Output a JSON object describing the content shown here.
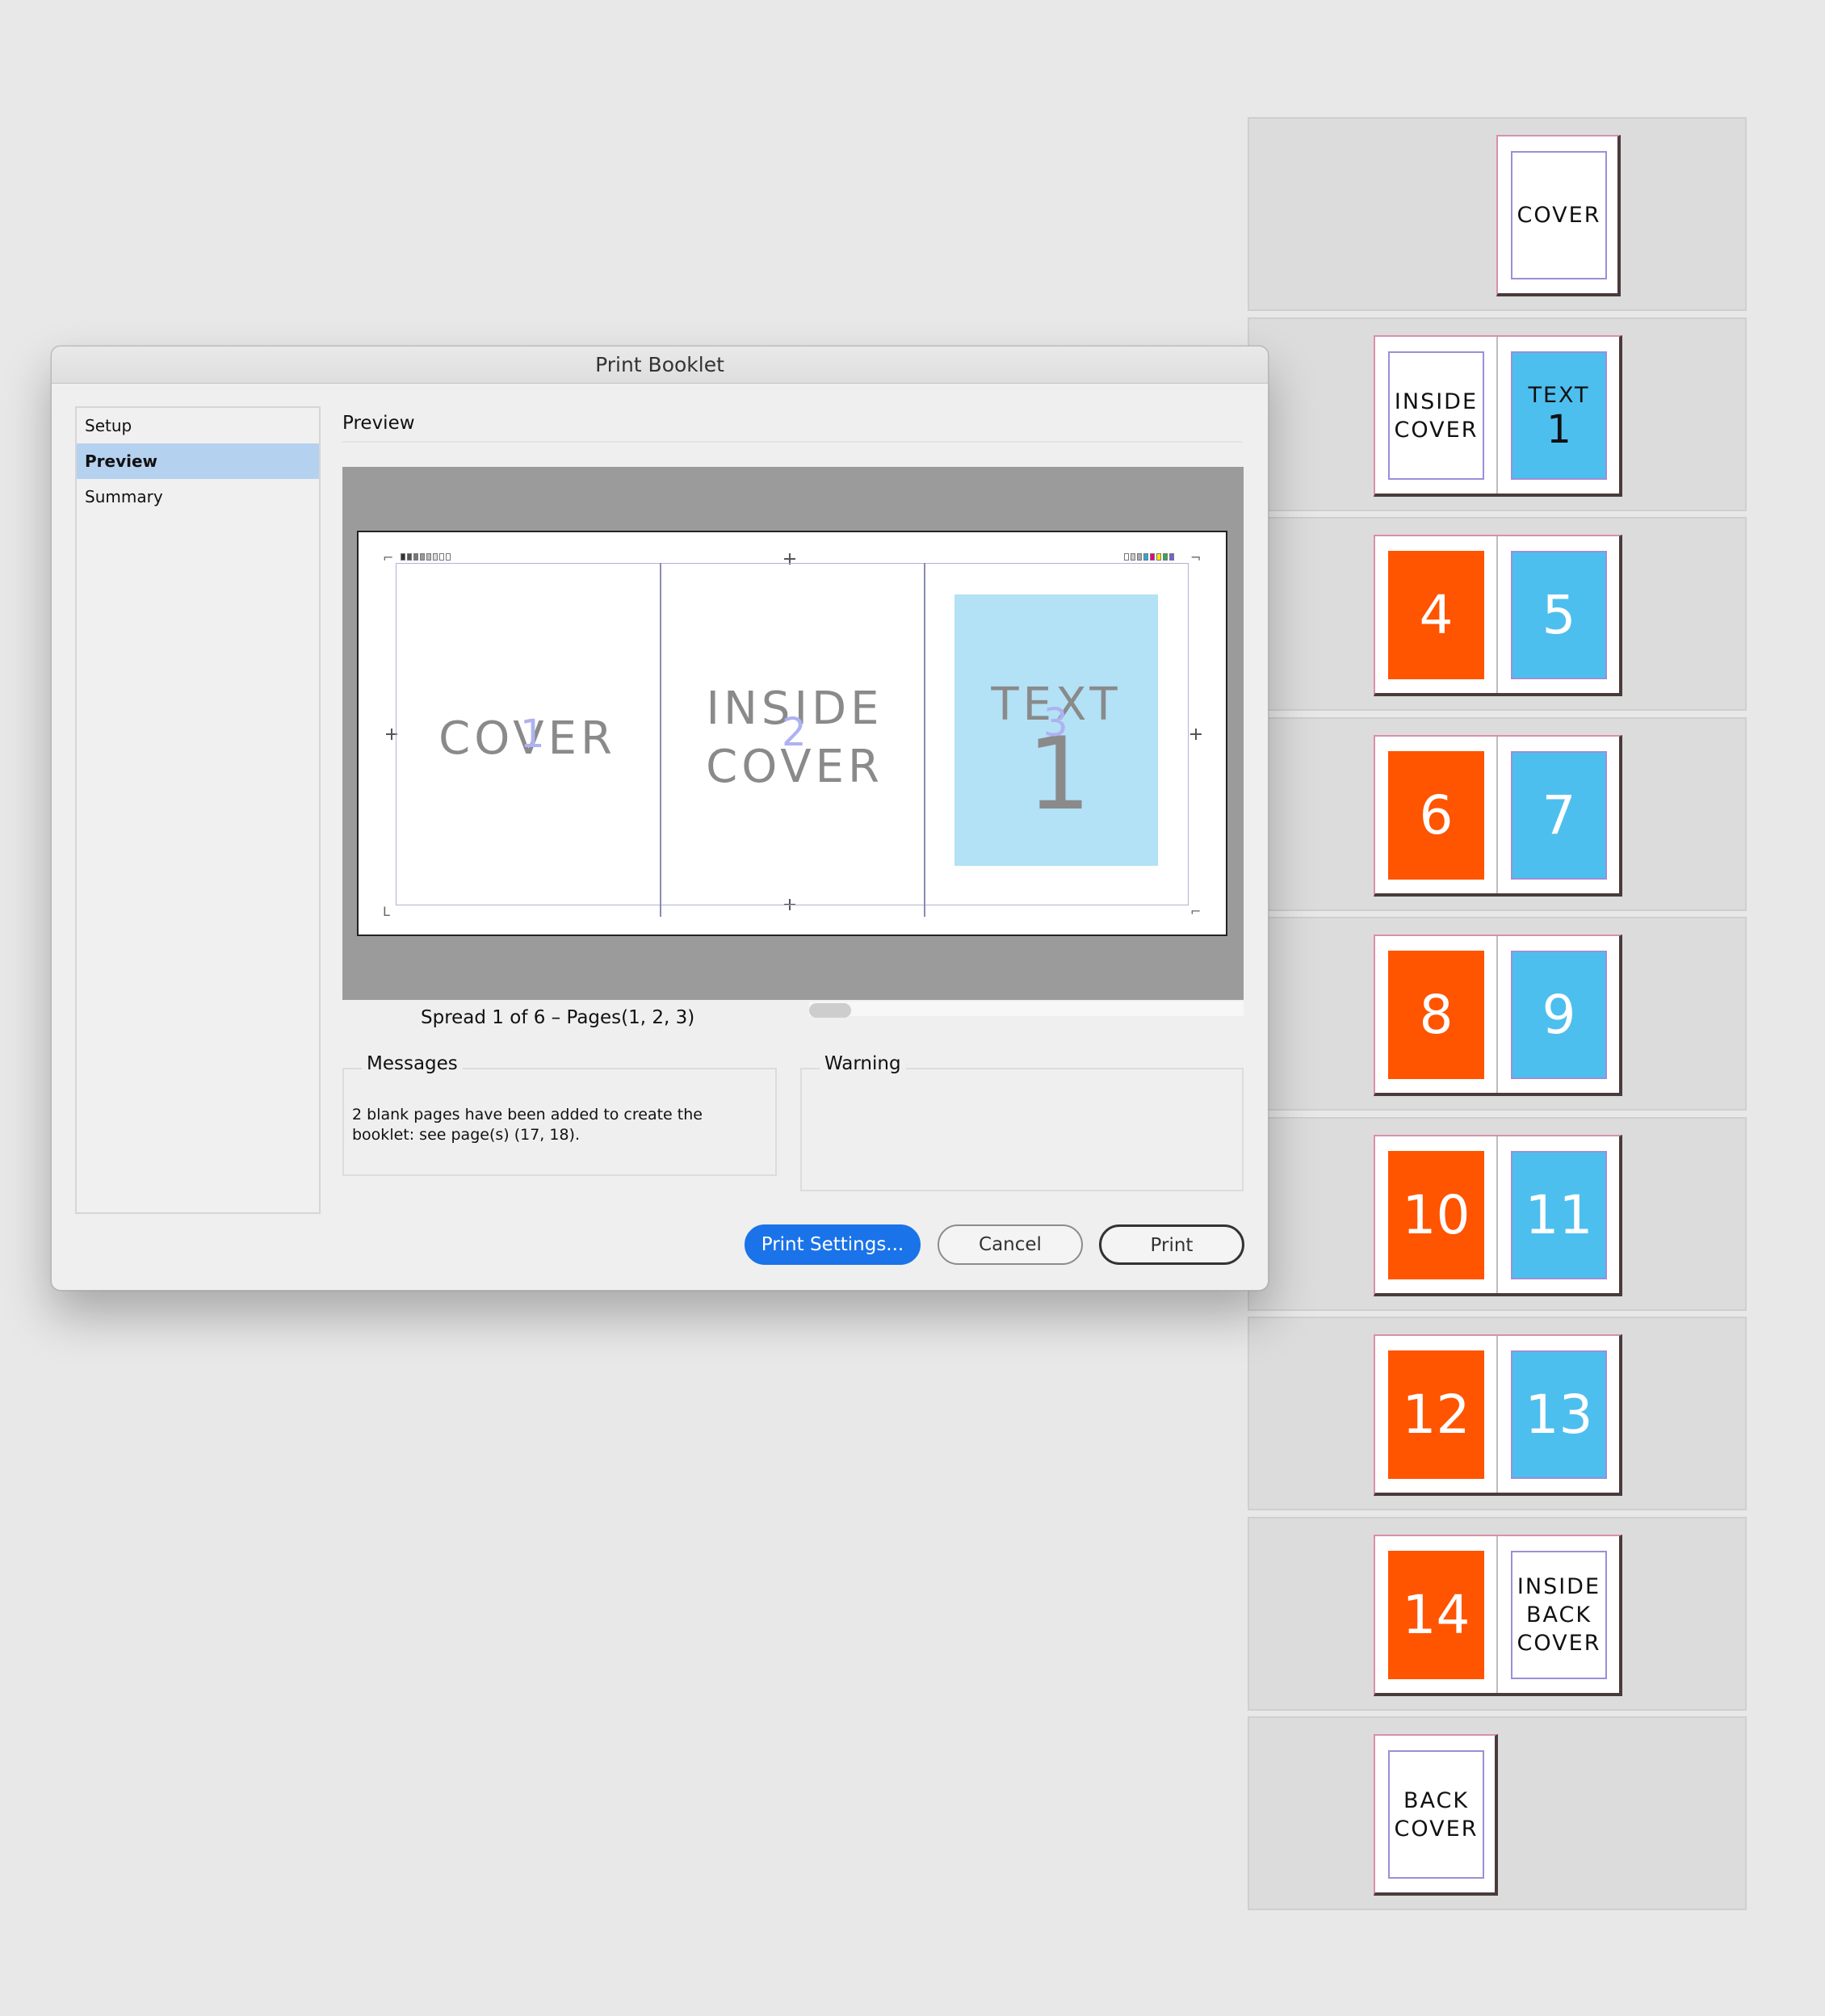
{
  "pages_panel": {
    "rows": [
      {
        "pages": [
          {
            "side": "single-right",
            "label": "COVER",
            "style": "plain"
          }
        ]
      },
      {
        "pages": [
          {
            "side": "left",
            "label": "INSIDE\nCOVER",
            "style": "plain"
          },
          {
            "side": "right",
            "label": "TEXT",
            "number": "1",
            "style": "blue-text"
          }
        ]
      },
      {
        "pages": [
          {
            "side": "left",
            "number": "4",
            "style": "orange"
          },
          {
            "side": "right",
            "number": "5",
            "style": "blue"
          }
        ]
      },
      {
        "pages": [
          {
            "side": "left",
            "number": "6",
            "style": "orange"
          },
          {
            "side": "right",
            "number": "7",
            "style": "blue"
          }
        ]
      },
      {
        "pages": [
          {
            "side": "left",
            "number": "8",
            "style": "orange"
          },
          {
            "side": "right",
            "number": "9",
            "style": "blue"
          }
        ]
      },
      {
        "pages": [
          {
            "side": "left",
            "number": "10",
            "style": "orange"
          },
          {
            "side": "right",
            "number": "11",
            "style": "blue"
          }
        ]
      },
      {
        "pages": [
          {
            "side": "left",
            "number": "12",
            "style": "orange"
          },
          {
            "side": "right",
            "number": "13",
            "style": "blue"
          }
        ]
      },
      {
        "pages": [
          {
            "side": "left",
            "number": "14",
            "style": "orange"
          },
          {
            "side": "right",
            "label": "INSIDE\nBACK\nCOVER",
            "style": "plain"
          }
        ]
      },
      {
        "pages": [
          {
            "side": "single-left",
            "label": "BACK\nCOVER",
            "style": "plain"
          }
        ]
      }
    ],
    "colors": {
      "orange": "#ff5400",
      "blue": "#4dbfee"
    }
  },
  "dialog": {
    "title": "Print Booklet",
    "sidebar": {
      "items": [
        {
          "label": "Setup",
          "active": false
        },
        {
          "label": "Preview",
          "active": true
        },
        {
          "label": "Summary",
          "active": false
        }
      ]
    },
    "section_title": "Preview",
    "preview": {
      "pages": [
        {
          "text": "COVER",
          "number": "1"
        },
        {
          "text": "INSIDE\nCOVER",
          "number": "2"
        },
        {
          "text": "TEXT",
          "big_number": "1",
          "number": "3"
        }
      ]
    },
    "spread_label": "Spread 1 of 6 – Pages(1, 2, 3)",
    "messages": {
      "title": "Messages",
      "body": "2 blank pages have been added to create the booklet: see page(s) (17, 18)."
    },
    "warning": {
      "title": "Warning",
      "body": ""
    },
    "buttons": {
      "print_settings": "Print Settings...",
      "cancel": "Cancel",
      "print": "Print"
    },
    "accent_color": "#1a73e8"
  }
}
